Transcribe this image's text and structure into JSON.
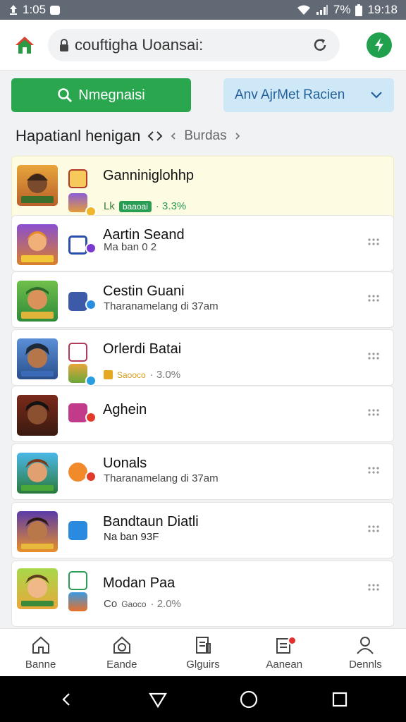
{
  "status_bar": {
    "left_text": "1:05",
    "battery": "7%",
    "time": "19:18"
  },
  "topbar": {
    "url": "couftigha Uoansai:"
  },
  "actions": {
    "primary_label": "Nmegnaisi",
    "secondary_label": "Anv AjrMet Racien"
  },
  "breadcrumb": {
    "main": "Hapatianl henigan",
    "sub": "Burdas"
  },
  "games": [
    {
      "title": "Ganniniglohhp",
      "stat_label": "Lk",
      "pill": "baaoai",
      "stat_value": "· 3.3%",
      "pill_color": "#2a9d55",
      "highlight": true
    },
    {
      "title": "Aartin Seand",
      "subtitle": "Ma ban 0 2"
    },
    {
      "title": "Cestin Guani",
      "subtitle": "Tharanamelang di 37am"
    },
    {
      "title": "Orlerdi Batai",
      "stat_label": "",
      "pill": "Saooco",
      "stat_value": "· 3.0%",
      "pill_color": "#d99a1c"
    },
    {
      "title": "Aghein"
    },
    {
      "title": "Uonals",
      "subtitle": "Tharanamelang di 37am"
    },
    {
      "title": "Bandtaun Diatli",
      "subtitle": "Na ban 93F"
    },
    {
      "title": "Modan Paa",
      "stat_label": "Co",
      "pill": "Gaoco",
      "stat_value": "· 2.0%",
      "pill_color": "#888888"
    }
  ],
  "bottom_nav": [
    {
      "label": "Banne",
      "icon": "home-icon"
    },
    {
      "label": "Eande",
      "icon": "gamepad-icon"
    },
    {
      "label": "Glguirs",
      "icon": "document-icon"
    },
    {
      "label": "Aanean",
      "icon": "notification-icon"
    },
    {
      "label": "Dennls",
      "icon": "person-icon"
    }
  ],
  "colors": {
    "primary": "#2aa64f",
    "secondary_bg": "#cfe8f7",
    "secondary_text": "#23609a",
    "highlight": "#fdfbe1",
    "status_bar": "#616a74"
  }
}
